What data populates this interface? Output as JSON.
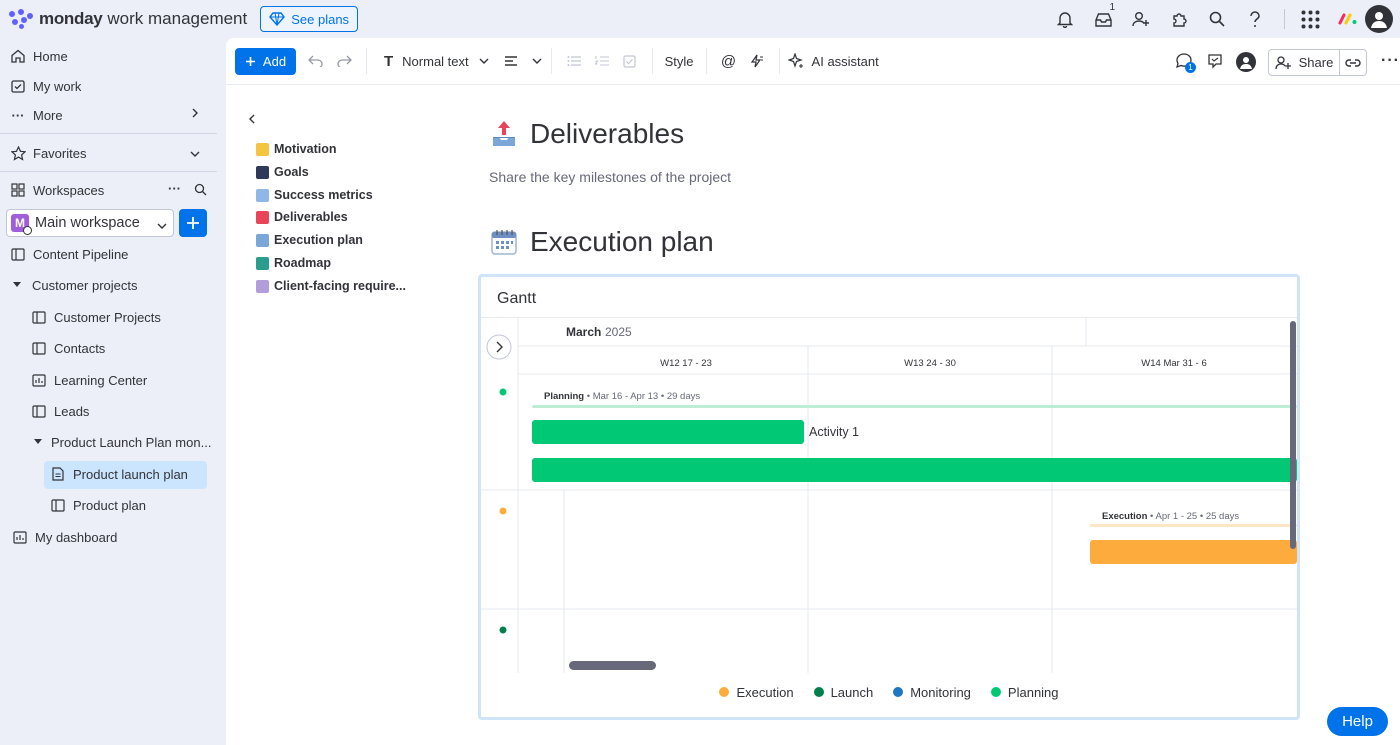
{
  "topbar": {
    "brand": "monday",
    "brand_sub": "work management",
    "see_plans": "See plans",
    "inbox_count": "1"
  },
  "sidebar": {
    "home": "Home",
    "my_work": "My work",
    "more": "More",
    "favorites": "Favorites",
    "workspaces": "Workspaces",
    "workspace_letter": "M",
    "workspace_name": "Main workspace",
    "items": [
      {
        "label": "Content Pipeline"
      },
      {
        "label": "Customer projects"
      },
      {
        "label": "Customer Projects"
      },
      {
        "label": "Contacts"
      },
      {
        "label": "Learning Center"
      },
      {
        "label": "Leads"
      },
      {
        "label": "Product Launch Plan mon..."
      },
      {
        "label": "Product launch plan"
      },
      {
        "label": "Product plan"
      },
      {
        "label": "My dashboard"
      }
    ]
  },
  "toolbar": {
    "add": "Add",
    "text_style": "Normal text",
    "style": "Style",
    "ai": "AI assistant",
    "share": "Share",
    "updates_count": "1"
  },
  "toc": {
    "items": [
      {
        "label": "Motivation",
        "color": "#f5c542"
      },
      {
        "label": "Goals",
        "color": "#2f3a5a"
      },
      {
        "label": "Success metrics",
        "color": "#8fb8e8"
      },
      {
        "label": "Deliverables",
        "color": "#e8445a"
      },
      {
        "label": "Execution plan",
        "color": "#7aa7d8"
      },
      {
        "label": "Roadmap",
        "color": "#2a9d8f"
      },
      {
        "label": "Client-facing require...",
        "color": "#b39ddb"
      }
    ]
  },
  "doc": {
    "deliverables_title": "Deliverables",
    "deliverables_sub": "Share the key milestones of the project",
    "execution_title": "Execution plan"
  },
  "gantt": {
    "title": "Gantt",
    "month": "March",
    "year": "2025",
    "weeks": [
      "W12 17 - 23",
      "W13 24 - 30",
      "W14 Mar 31 - 6"
    ],
    "groups": [
      {
        "name": "Planning",
        "range": "Mar 16 - Apr 13",
        "days": "29 days",
        "color": "#00c875"
      },
      {
        "name": "Execution",
        "range": "Apr 1 - 25",
        "days": "25 days",
        "color": "#fdab3d"
      },
      {
        "name": "Launch",
        "color": "#037f4c"
      }
    ],
    "activity": "Activity 1",
    "legend": [
      {
        "label": "Execution",
        "color": "#fdab3d"
      },
      {
        "label": "Launch",
        "color": "#037f4c"
      },
      {
        "label": "Monitoring",
        "color": "#1f76c2"
      },
      {
        "label": "Planning",
        "color": "#00c875"
      }
    ]
  },
  "help": "Help"
}
